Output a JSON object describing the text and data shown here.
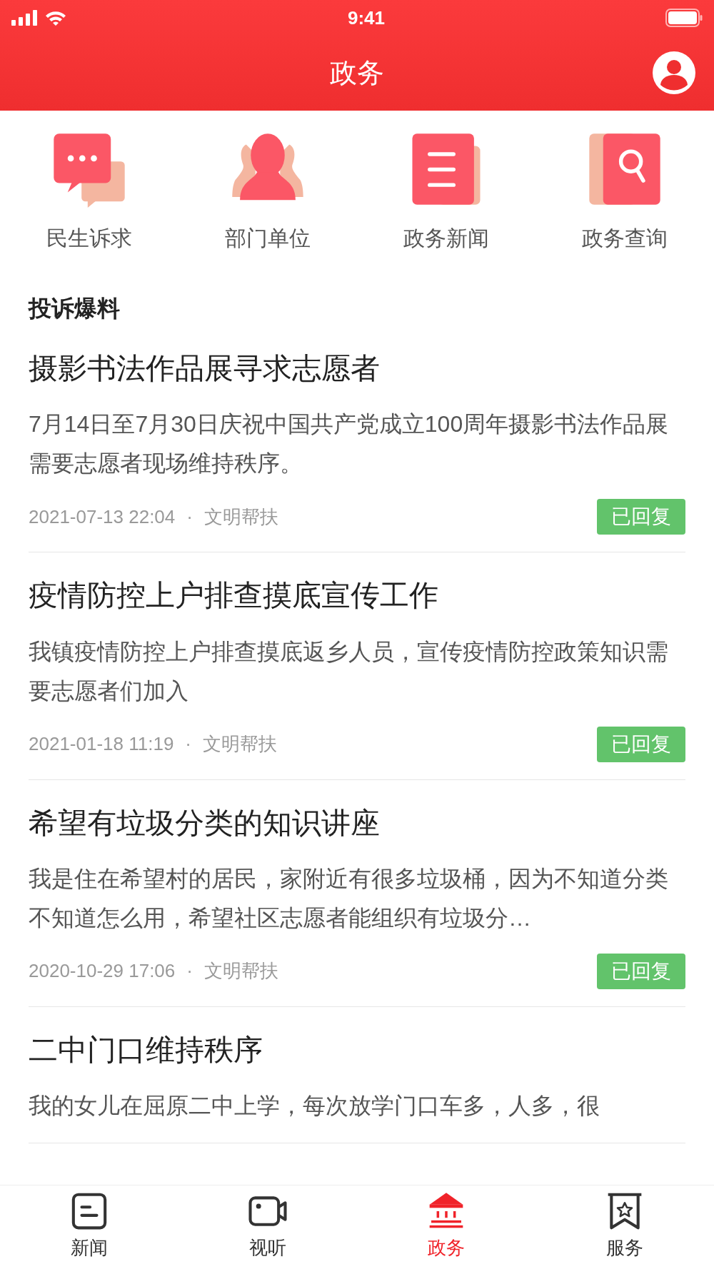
{
  "status_bar": {
    "time": "9:41"
  },
  "header": {
    "title": "政务"
  },
  "shortcuts": [
    {
      "label": "民生诉求",
      "kind": "chat"
    },
    {
      "label": "部门单位",
      "kind": "people"
    },
    {
      "label": "政务新闻",
      "kind": "news"
    },
    {
      "label": "政务查询",
      "kind": "search"
    }
  ],
  "section": {
    "title": "投诉爆料"
  },
  "posts": [
    {
      "title": "摄影书法作品展寻求志愿者",
      "summary": "7月14日至7月30日庆祝中国共产党成立100周年摄影书法作品展需要志愿者现场维持秩序。",
      "date": "2021-07-13 22:04",
      "separator": "·",
      "category": "文明帮扶",
      "status": "已回复"
    },
    {
      "title": "疫情防控上户排查摸底宣传工作",
      "summary": "我镇疫情防控上户排查摸底返乡人员，宣传疫情防控政策知识需要志愿者们加入",
      "date": "2021-01-18 11:19",
      "separator": "·",
      "category": "文明帮扶",
      "status": "已回复"
    },
    {
      "title": "希望有垃圾分类的知识讲座",
      "summary": "我是住在希望村的居民，家附近有很多垃圾桶，因为不知道分类不知道怎么用，希望社区志愿者能组织有垃圾分…",
      "date": "2020-10-29 17:06",
      "separator": "·",
      "category": "文明帮扶",
      "status": "已回复"
    },
    {
      "title": "二中门口维持秩序",
      "summary": "我的女儿在屈原二中上学，每次放学门口车多，人多，很"
    }
  ],
  "tab_bar": [
    {
      "label": "新闻",
      "kind": "news",
      "selected": false
    },
    {
      "label": "视听",
      "kind": "video",
      "selected": false
    },
    {
      "label": "政务",
      "kind": "gov",
      "selected": true
    },
    {
      "label": "服务",
      "kind": "service",
      "selected": false
    }
  ]
}
